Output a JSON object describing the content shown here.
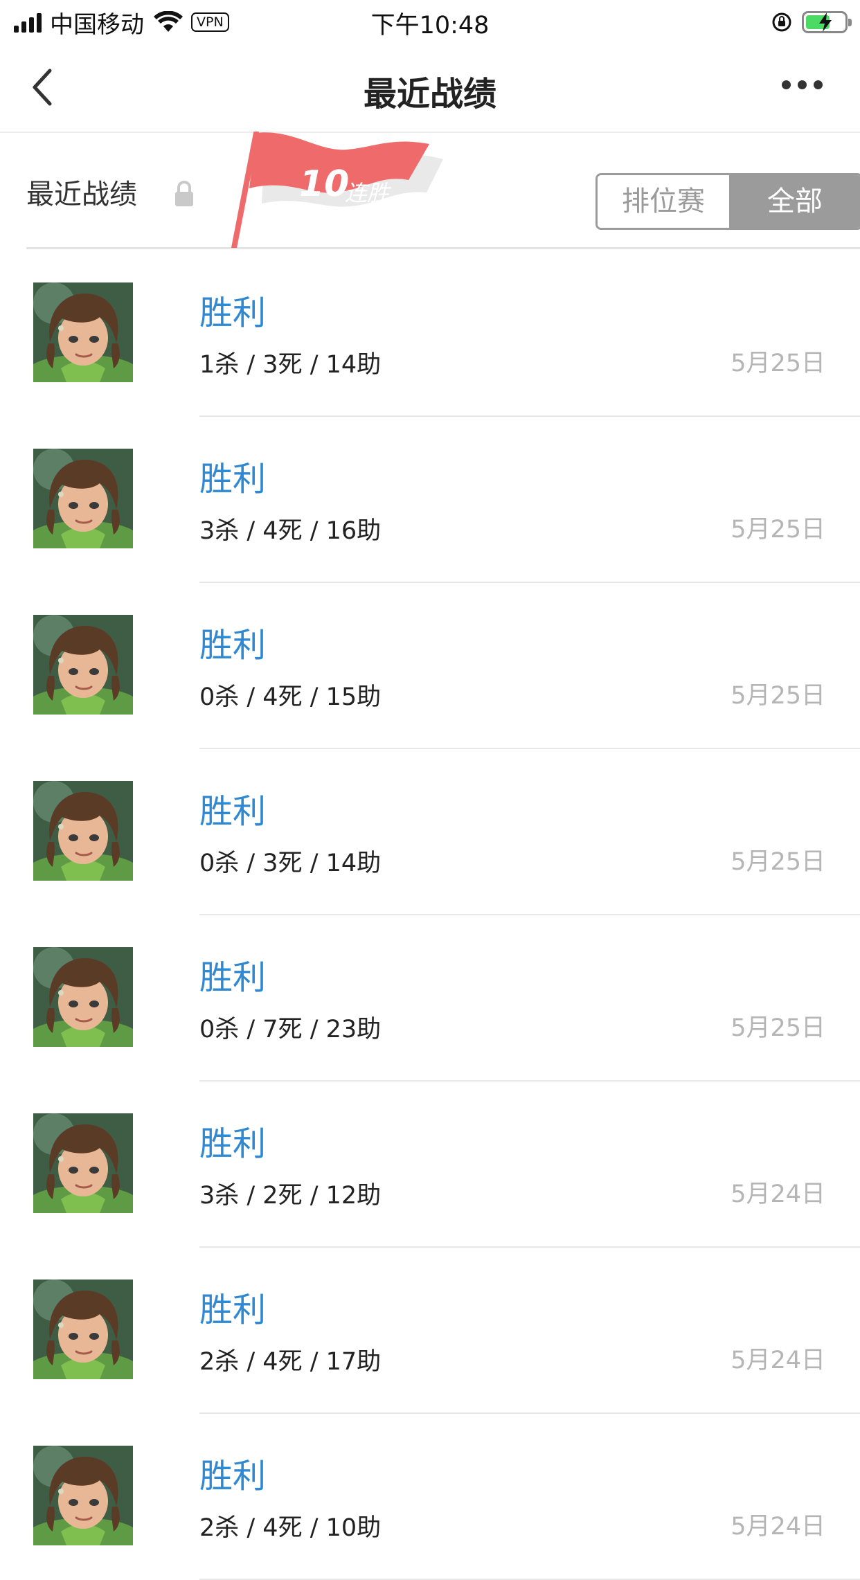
{
  "status_bar": {
    "carrier": "中国移动",
    "vpn": "VPN",
    "time": "下午10:48"
  },
  "nav": {
    "title": "最近战绩"
  },
  "section": {
    "title": "最近战绩",
    "streak_number": "10",
    "streak_label": "连胜",
    "filter_options": [
      "排位赛",
      "全部"
    ],
    "filter_selected": "全部"
  },
  "matches": [
    {
      "result": "胜利",
      "kda": "1杀 / 3死 / 14助",
      "date": "5月25日"
    },
    {
      "result": "胜利",
      "kda": "3杀 / 4死 / 16助",
      "date": "5月25日"
    },
    {
      "result": "胜利",
      "kda": "0杀 / 4死 / 15助",
      "date": "5月25日"
    },
    {
      "result": "胜利",
      "kda": "0杀 / 3死 / 14助",
      "date": "5月25日"
    },
    {
      "result": "胜利",
      "kda": "0杀 / 7死 / 23助",
      "date": "5月25日"
    },
    {
      "result": "胜利",
      "kda": "3杀 / 2死 / 12助",
      "date": "5月24日"
    },
    {
      "result": "胜利",
      "kda": "2杀 / 4死 / 17助",
      "date": "5月24日"
    },
    {
      "result": "胜利",
      "kda": "2杀 / 4死 / 10助",
      "date": "5月24日"
    }
  ],
  "colors": {
    "win": "#2e88d2",
    "flag": "#ef6b6b",
    "battery": "#4cd964"
  },
  "icons": {
    "back": "chevron-left-icon",
    "more": "more-dots-icon",
    "lock": "lock-icon",
    "hero_avatar": "hero-avatar-icon"
  }
}
